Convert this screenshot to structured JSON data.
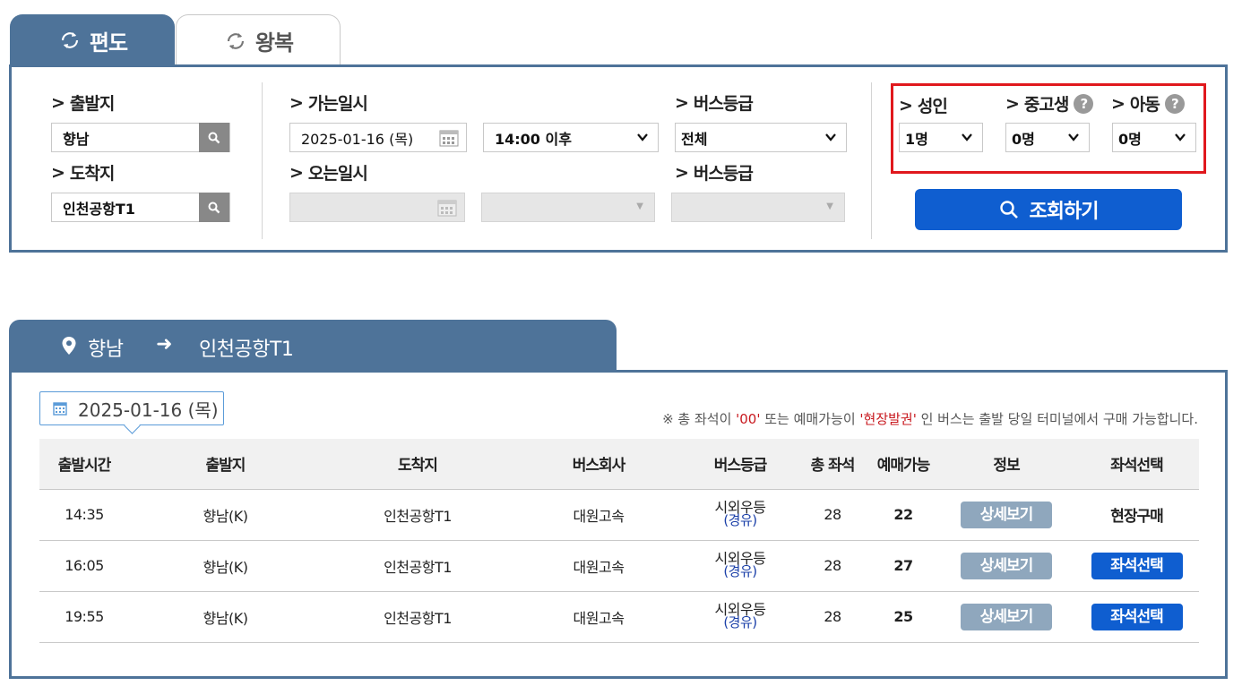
{
  "tabs": {
    "one_way": "편도",
    "round_trip": "왕복"
  },
  "search": {
    "departure_label": "출발지",
    "departure_value": "향남",
    "arrival_label": "도착지",
    "arrival_value": "인천공항T1",
    "go_date_label": "가는일시",
    "go_date_value": "2025-01-16 (목)",
    "go_time_value": "14:00 이후",
    "bus_grade_label": "버스등급",
    "bus_grade_value": "전체",
    "return_date_label": "오는일시",
    "return_grade_label": "버스등급",
    "adult_label": "성인",
    "adult_value": "1명",
    "student_label": "중고생",
    "student_value": "0명",
    "child_label": "아동",
    "child_value": "0명",
    "help_mark": "?",
    "submit_label": "조회하기"
  },
  "route": {
    "from": "향남",
    "arrow": "➜",
    "to": "인천공항T1"
  },
  "results": {
    "date": "2025-01-16 (목)",
    "notice_prefix": "※ 총 좌석이 ",
    "notice_q1": "'00'",
    "notice_mid": " 또는 예매가능이 ",
    "notice_q2": "'현장발권'",
    "notice_suffix": " 인 버스는 출발 당일 터미널에서 구매 가능합니다.",
    "columns": [
      "출발시간",
      "출발지",
      "도착지",
      "버스회사",
      "버스등급",
      "총 좌석",
      "예매가능",
      "정보",
      "좌석선택"
    ],
    "rows": [
      {
        "time": "14:35",
        "from": "향남(K)",
        "to": "인천공항T1",
        "company": "대원고속",
        "grade": "시외우등",
        "grade_via": "(경유)",
        "total": "28",
        "available": "22",
        "info": "상세보기",
        "select": "현장구매"
      },
      {
        "time": "16:05",
        "from": "향남(K)",
        "to": "인천공항T1",
        "company": "대원고속",
        "grade": "시외우등",
        "grade_via": "(경유)",
        "total": "28",
        "available": "27",
        "info": "상세보기",
        "select": "좌석선택"
      },
      {
        "time": "19:55",
        "from": "향남(K)",
        "to": "인천공항T1",
        "company": "대원고속",
        "grade": "시외우등",
        "grade_via": "(경유)",
        "total": "28",
        "available": "25",
        "info": "상세보기",
        "select": "좌석선택"
      }
    ]
  },
  "colors": {
    "primary_blue": "#4e7399",
    "action_blue": "#0f5ed0",
    "highlight_red": "#e0181d",
    "detail_gray": "#8fa7bd"
  },
  "icons": {
    "tab": "refresh-icon",
    "search": "magnifier-icon",
    "calendar": "calendar-icon",
    "route": "location-pin-icon"
  }
}
